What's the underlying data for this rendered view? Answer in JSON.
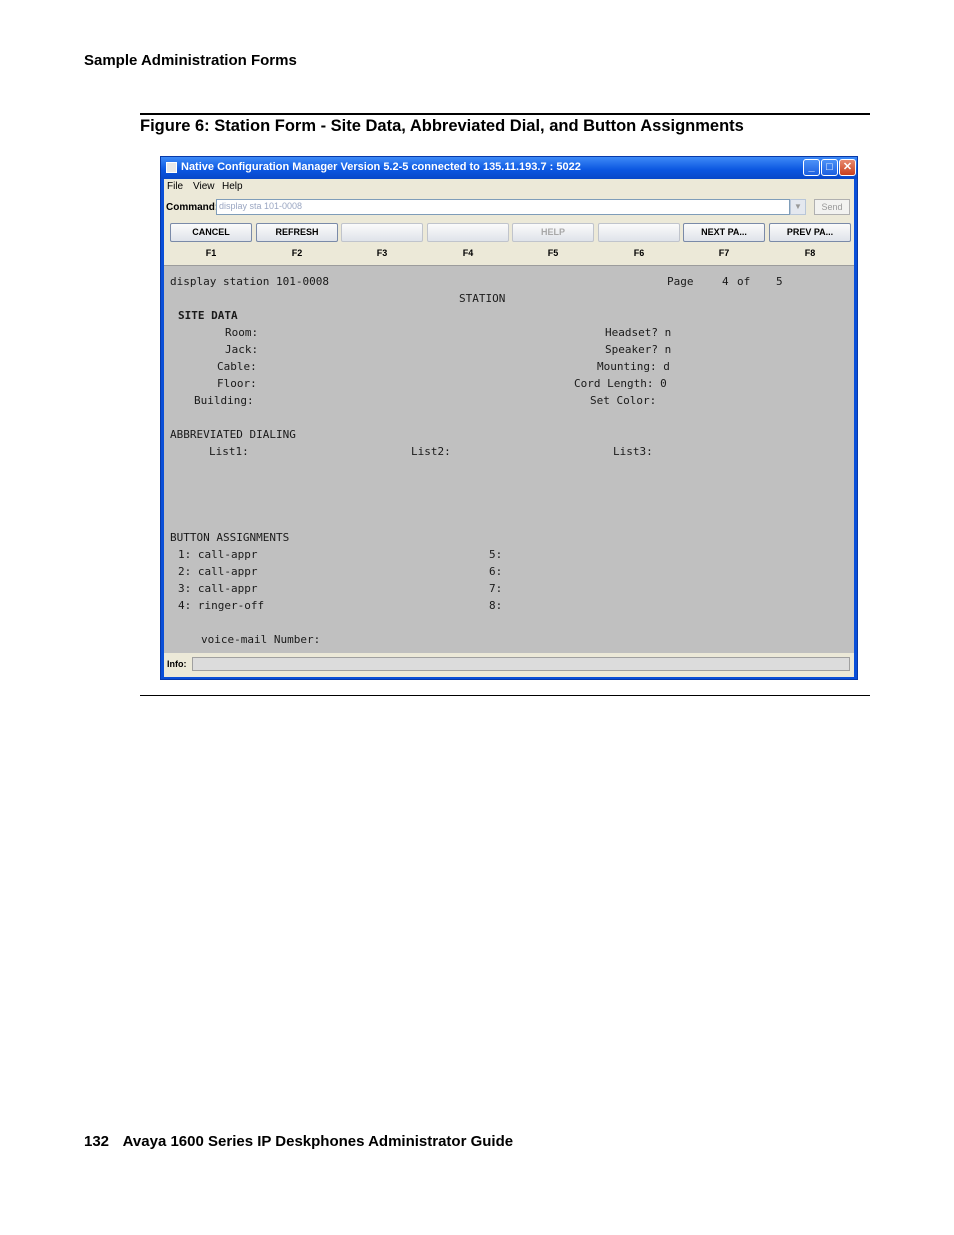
{
  "page": {
    "running_head": "Sample Administration Forms",
    "figure_caption": "Figure 6: Station Form - Site Data, Abbreviated Dial, and Button Assignments",
    "footer_page": "132",
    "footer_title": "Avaya 1600 Series IP Deskphones Administrator Guide"
  },
  "window": {
    "title": "Native Configuration Manager Version 5.2-5 connected to 135.11.193.7 : 5022",
    "menu": [
      "File",
      "View",
      "Help"
    ],
    "command_label": "Command:",
    "command_value": "display sta 101-0008",
    "send_label": "Send",
    "fkeys": [
      {
        "label": "CANCEL",
        "key": "F1"
      },
      {
        "label": "REFRESH",
        "key": "F2"
      },
      {
        "label": "",
        "key": "F3"
      },
      {
        "label": "",
        "key": "F4"
      },
      {
        "label": "HELP",
        "key": "F5"
      },
      {
        "label": "",
        "key": "F6"
      },
      {
        "label": "NEXT PA...",
        "key": "F7"
      },
      {
        "label": "PREV PA...",
        "key": "F8"
      }
    ],
    "info_label": "Info:"
  },
  "screen": {
    "command_echo": "display station 101-0008",
    "page_label": "Page",
    "page_num": "4",
    "page_of": "of",
    "page_total": "5",
    "form_title": "STATION",
    "site_data_header": "SITE DATA",
    "room": "Room:",
    "jack": "Jack:",
    "cable": "Cable:",
    "floor": "Floor:",
    "building": "Building:",
    "headset": "Headset? n",
    "speaker": "Speaker? n",
    "mounting": "Mounting: d",
    "cord_length": "Cord Length: 0",
    "set_color": "Set Color:",
    "abbrev_header": "ABBREVIATED DIALING",
    "list1": "List1:",
    "list2": "List2:",
    "list3": "List3:",
    "button_header": "BUTTON ASSIGNMENTS",
    "buttons": [
      "1: call-appr",
      "2: call-appr",
      "3: call-appr",
      "4: ringer-off"
    ],
    "buttons_right": [
      "5:",
      "6:",
      "7:",
      "8:"
    ],
    "voice_mail": "voice-mail Number:"
  }
}
